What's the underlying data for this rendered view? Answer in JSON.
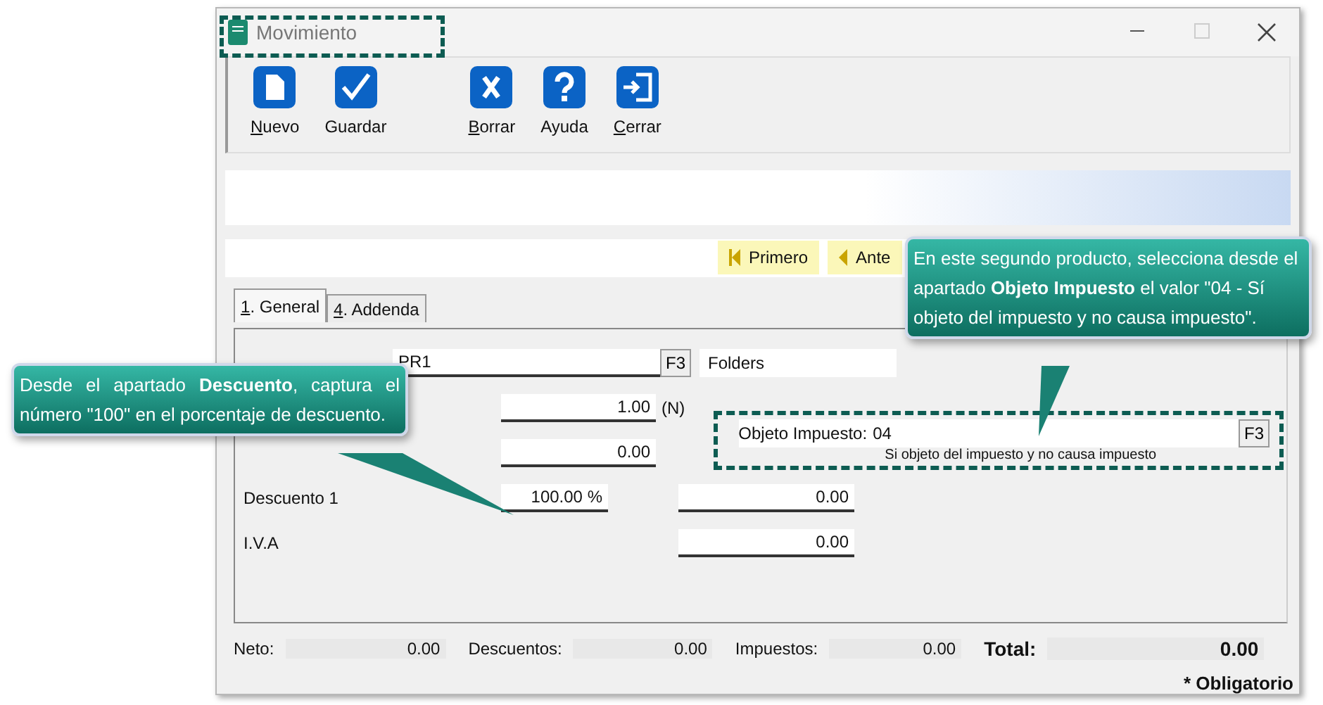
{
  "window": {
    "title": "Movimiento",
    "highlighted": true
  },
  "toolbar": [
    {
      "label": "Nuevo",
      "kind": "new",
      "underline_first": true
    },
    {
      "label": "Guardar",
      "kind": "save",
      "underline_first": false
    },
    {
      "label": "Borrar",
      "kind": "delete",
      "underline_first": true
    },
    {
      "label": "Ayuda",
      "kind": "help",
      "underline_first": false
    },
    {
      "label": "Cerrar",
      "kind": "close",
      "underline_first": true
    }
  ],
  "navigation": [
    {
      "label": "Primero",
      "kind": "first"
    },
    {
      "label": "Ante",
      "kind": "previous"
    }
  ],
  "tabs": [
    {
      "label": "1. General",
      "selected": true,
      "underline_first": true
    },
    {
      "label": "4. Addenda",
      "selected": false,
      "underline_first": true
    }
  ],
  "form": {
    "service_code": "PR1",
    "service_key": "F3",
    "service_name": "Folders",
    "quantity": "1.00",
    "quantity_unit": "(N)",
    "price": "0.00",
    "tax_object": {
      "label": "Objeto Impuesto:",
      "value": "04",
      "description": "Si objeto del impuesto y no causa impuesto",
      "key": "F3",
      "highlighted": true
    },
    "discount_label": "Descuento 1",
    "discount_percent": "100.00 %",
    "discount_amount": "0.00",
    "vat_label": "I.V.A",
    "vat_amount": "0.00"
  },
  "totals": [
    {
      "label": "Neto:",
      "value": "0.00",
      "kind": "normal"
    },
    {
      "label": "Descuentos:",
      "value": "0.00",
      "kind": "normal"
    },
    {
      "label": "Impuestos:",
      "value": "0.00",
      "kind": "normal"
    },
    {
      "label": "Total:",
      "value": "0.00",
      "kind": "total"
    }
  ],
  "required_note": "* Obligatorio",
  "callouts": [
    {
      "text": "Desde el apartado **Descuento**, captura el número \"100\" en el porcentaje de descuento.",
      "kind": "left"
    },
    {
      "text": "En este segundo producto, selecciona desde el apartado **Objeto Impuesto** el valor \"04 - Sí objeto del impuesto y no causa impuesto\".",
      "kind": "right"
    }
  ]
}
